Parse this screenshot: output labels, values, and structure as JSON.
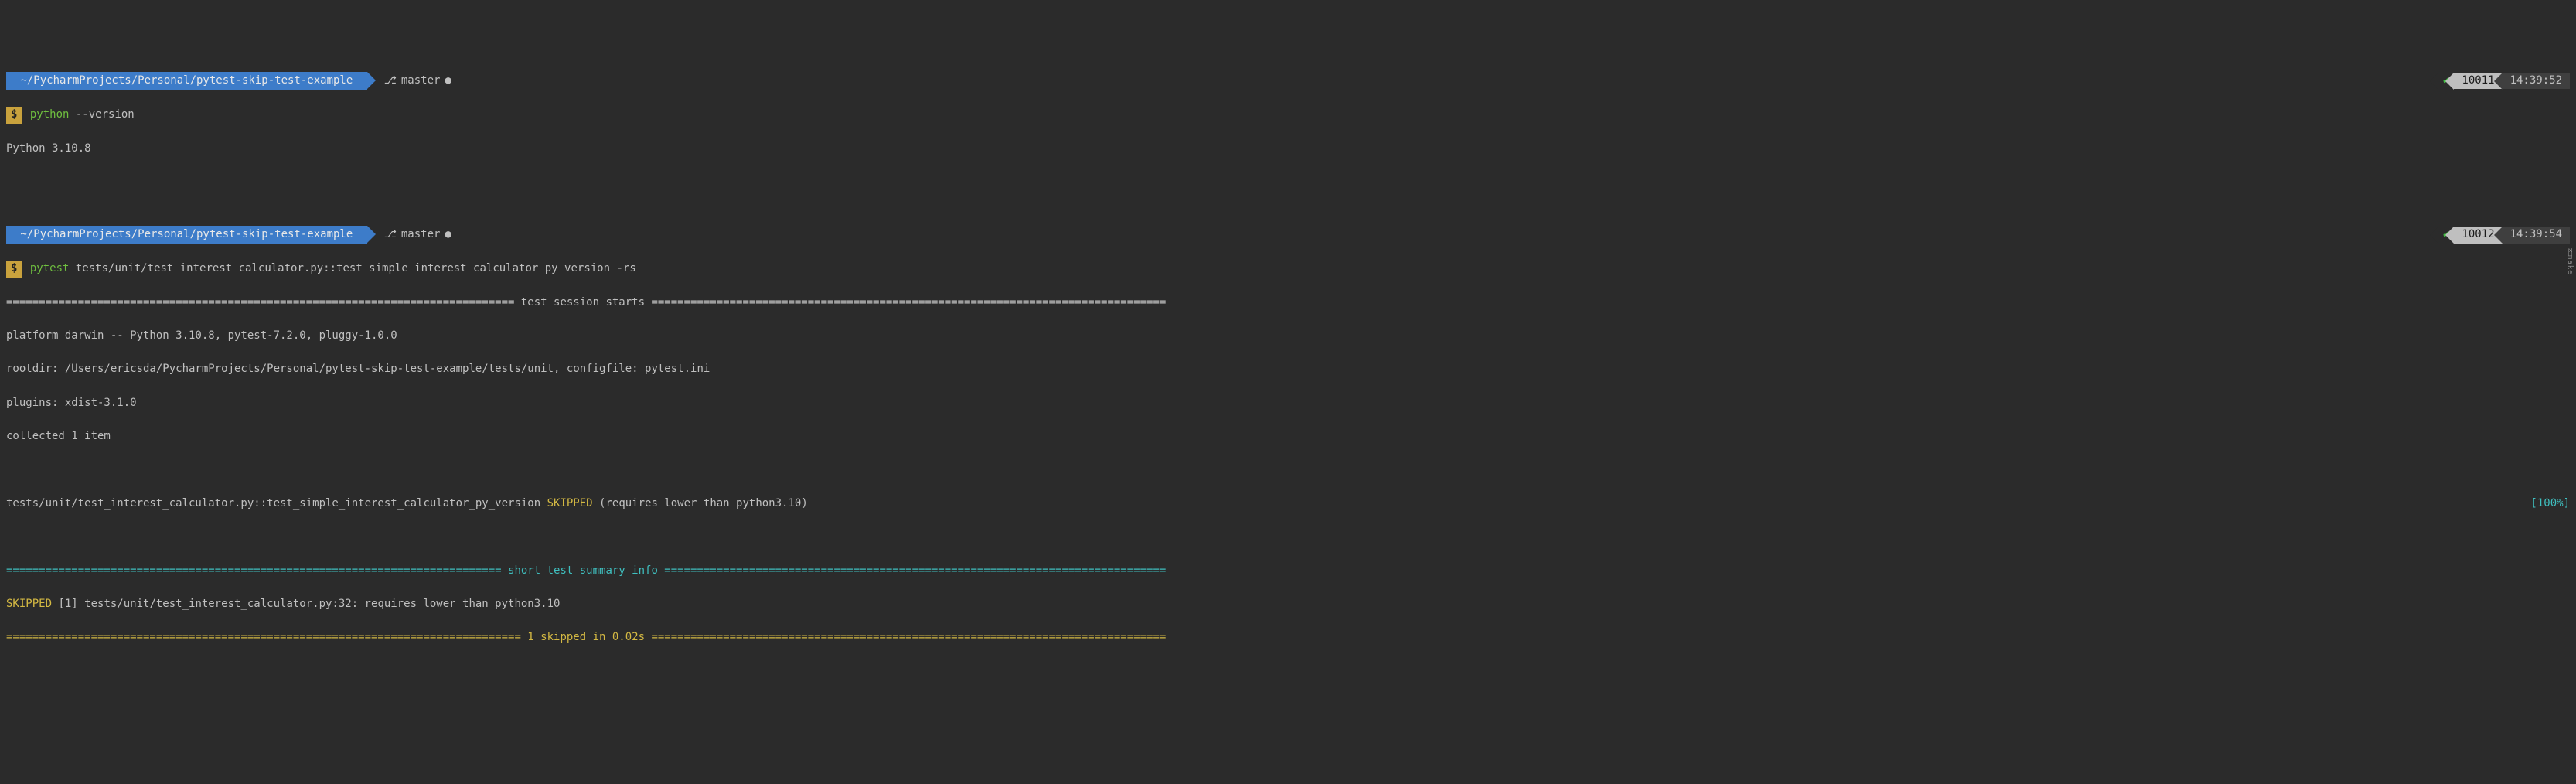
{
  "prompts": [
    {
      "path": " ~/PycharmProjects/Personal/pytest-skip-test-example ",
      "branch": "master",
      "check": "✔",
      "cmd_num": "10011",
      "time": "14:39:52",
      "dollar": "$",
      "command_exe": "python",
      "command_args": " --version"
    },
    {
      "path": " ~/PycharmProjects/Personal/pytest-skip-test-example ",
      "branch": "master",
      "check": "✔",
      "cmd_num": "10012",
      "time": "14:39:54",
      "dollar": "$",
      "command_exe": "pytest",
      "command_args": " tests/unit/test_interest_calculator.py::test_simple_interest_calculator_py_version -rs"
    }
  ],
  "output1": "Python 3.10.8",
  "session": {
    "header": "============================================================================== test session starts ===============================================================================",
    "platform": "platform darwin -- Python 3.10.8, pytest-7.2.0, pluggy-1.0.0",
    "rootdir": "rootdir: /Users/ericsda/PycharmProjects/Personal/pytest-skip-test-example/tests/unit, configfile: pytest.ini",
    "plugins": "plugins: xdist-3.1.0",
    "collected": "collected 1 item",
    "test_path": "tests/unit/test_interest_calculator.py::test_simple_interest_calculator_py_version ",
    "skipped_word": "SKIPPED",
    "skip_reason": " (requires lower than python3.10)",
    "pct": "[100%]",
    "summary_header": "============================================================================ short test summary info =============================================================================",
    "summary_skipped": "SKIPPED",
    "summary_detail": " [1] tests/unit/test_interest_calculator.py:32: requires lower than python3.10",
    "footer": "=============================================================================== 1 skipped in 0.02s ==============================================================================="
  },
  "sidebar": {
    "sym": "ᛗ",
    "text": "make"
  }
}
